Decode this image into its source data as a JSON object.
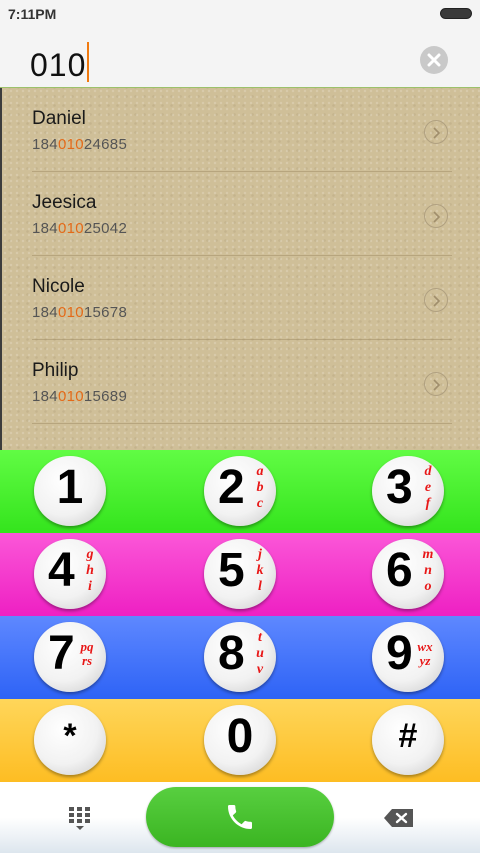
{
  "status_bar": {
    "time": "7:11PM"
  },
  "search": {
    "value": "010"
  },
  "contacts": [
    {
      "name": "Daniel",
      "number_prefix": "184",
      "number_match": "010",
      "number_suffix": "24685"
    },
    {
      "name": "Jeesica",
      "number_prefix": "184",
      "number_match": "010",
      "number_suffix": "25042"
    },
    {
      "name": "Nicole",
      "number_prefix": "184",
      "number_match": "010",
      "number_suffix": "15678"
    },
    {
      "name": "Philip",
      "number_prefix": "184",
      "number_match": "010",
      "number_suffix": "15689"
    }
  ],
  "keypad": {
    "k1": {
      "digit": "1",
      "letters": ""
    },
    "k2": {
      "digit": "2",
      "letters": "a b c"
    },
    "k3": {
      "digit": "3",
      "letters": "d e f"
    },
    "k4": {
      "digit": "4",
      "letters": "g h i"
    },
    "k5": {
      "digit": "5",
      "letters": "j k l"
    },
    "k6": {
      "digit": "6",
      "letters": "m n o"
    },
    "k7": {
      "digit": "7",
      "letters": "pq rs"
    },
    "k8": {
      "digit": "8",
      "letters": "t u v"
    },
    "k9": {
      "digit": "9",
      "letters": "wx yz"
    },
    "kstar": {
      "digit": "*"
    },
    "k0": {
      "digit": "0"
    },
    "khash": {
      "digit": "#"
    }
  },
  "colors": {
    "accent": "#e46a18",
    "row1": "#4cf02f",
    "row2": "#f438cd",
    "row3": "#4675fb",
    "row4": "#fdc93e",
    "call": "#4ac131",
    "letters": "#e81717"
  },
  "icons": [
    "battery-icon",
    "clear-icon",
    "chevron-right-icon",
    "dialpad-icon",
    "phone-icon",
    "backspace-icon"
  ]
}
